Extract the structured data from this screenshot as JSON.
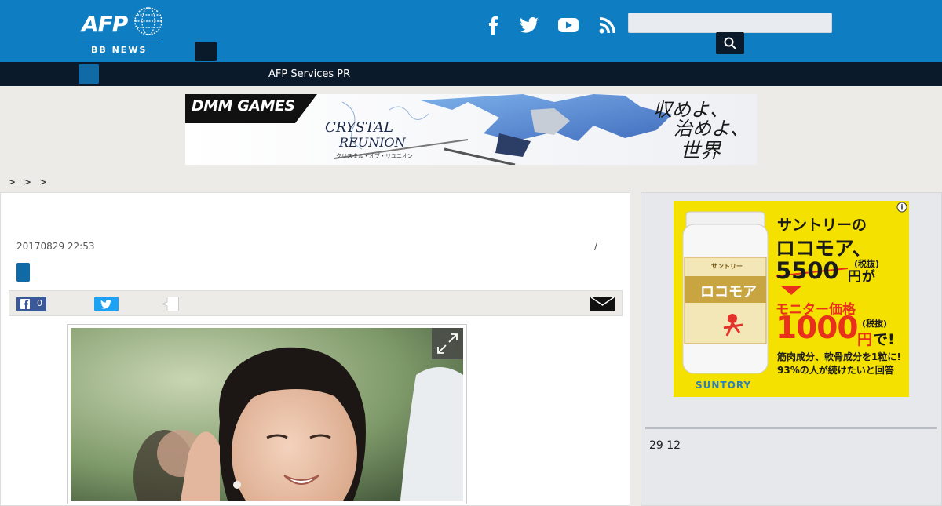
{
  "header": {
    "logo_text": "AFP",
    "logo_sub": "BB NEWS",
    "social": [
      {
        "name": "facebook",
        "icon": "facebook-icon"
      },
      {
        "name": "twitter",
        "icon": "twitter-icon"
      },
      {
        "name": "youtube",
        "icon": "youtube-icon"
      },
      {
        "name": "rss",
        "icon": "rss-icon"
      }
    ],
    "search": {
      "placeholder": "",
      "value": ""
    },
    "search_icon": "search-icon"
  },
  "nav": {
    "link_label": "AFP Services PR"
  },
  "banner": {
    "brand": "DMM GAMES",
    "game_title_line1": "CRYSTAL",
    "game_title_line2": "REUNION",
    "game_title_jp": "クリスタル・オブ・リユニオン",
    "tagline_line1": "収めよ、",
    "tagline_line2": "治めよ、",
    "tagline_line3": "世界を。"
  },
  "breadcrumb": "> > >",
  "article": {
    "date": "20170829 22:53",
    "separator": "/",
    "share": {
      "facebook_count": "0"
    }
  },
  "sidebar": {
    "ad": {
      "line1": "サントリーの",
      "line2": "ロコモア、",
      "price_old": "5500",
      "price_old_unit": "円",
      "price_old_suffix": "が",
      "tax_note": "(税抜)",
      "monitor": "モニター価格",
      "price_new": "1000",
      "price_new_unit": "円",
      "price_new_suffix": "で!",
      "tax_note2": "(税抜)",
      "desc1": "筋肉成分、軟骨成分を1粒に!",
      "desc2": "93%の人が続けたいと回答",
      "brand": "SUNTORY",
      "bottle_label": "ロコモア",
      "bottle_brand": "サントリー"
    },
    "date_text": "29 12"
  },
  "colors": {
    "header_blue": "#0f7dc2",
    "nav_dark": "#0b1a2b",
    "ad_yellow": "#f5e100",
    "accent_red": "#e8301c"
  }
}
